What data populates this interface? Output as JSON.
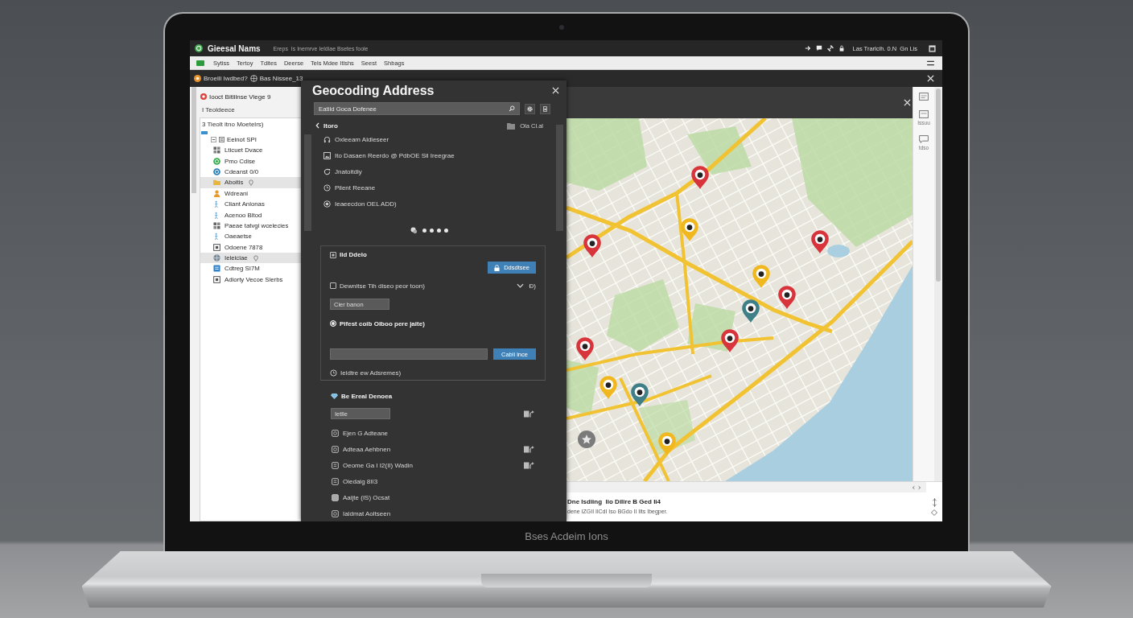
{
  "app": {
    "title": "Gieesal Nams",
    "menu_hint": "Ereps  Is Inemrve Ieldiae Bsetes foole",
    "status": "Las Trarlcih. 0.N  Gn Lis"
  },
  "menu": [
    "Sytiss",
    "Tertoy",
    "Tdites",
    "Deerse",
    "Tels Mdee Itlshs",
    "Seest",
    "Shbags"
  ],
  "tab": {
    "label": "Broeili Iwdbed?",
    "file": "Bas Nissee_13"
  },
  "sidebar": {
    "header": "Iooct Bitlilnse Viege 9",
    "lines": [
      "I Teoldeece",
      "3 Tieolt itno Moetelrs)"
    ],
    "tree": {
      "label": "Eeinot SPI",
      "expanded": true,
      "children": [
        {
          "label": "Lticuet Dvace",
          "selected": false,
          "pinned": false
        },
        {
          "label": "Pmo Cdise",
          "selected": false,
          "pinned": false
        },
        {
          "label": "Cdeanst 0/0",
          "selected": false,
          "pinned": false
        },
        {
          "label": "Aboitis",
          "selected": true,
          "pinned": true
        },
        {
          "label": "Wdreani",
          "selected": false,
          "pinned": false
        },
        {
          "label": "Cliant Anlonas",
          "selected": false,
          "pinned": false
        },
        {
          "label": "Acenoo Bltod",
          "selected": false,
          "pinned": false
        },
        {
          "label": "Paeae tatvgi wcelecies",
          "selected": false,
          "pinned": false
        },
        {
          "label": "Oaeaetse",
          "selected": false,
          "pinned": false
        },
        {
          "label": "Odoene 7878",
          "selected": false,
          "pinned": false
        },
        {
          "label": "Ieleiclae",
          "selected": true,
          "pinned": true
        },
        {
          "label": "Cdtreg SI7M",
          "selected": false,
          "pinned": false
        },
        {
          "label": "Adiorty Vecoe Slerbs",
          "selected": false,
          "pinned": false
        }
      ]
    }
  },
  "dialog": {
    "title": "Geocoding Address",
    "search": {
      "value": "Eatild Goca Dofenee"
    },
    "back": "Itoro",
    "folder": "Ola Cl.al",
    "results": [
      "Oxleeam Aldleseer",
      "Ito Dasaen Reerdo @ PdbOE Sil Ireegrae",
      "Jnatoitdiy",
      "Pilent Reeane",
      "Ieaeecdon OEL ADD)"
    ],
    "options": {
      "heading": {
        "label": "Ild Ddelo",
        "checked": true
      },
      "action": "Ddsdtsee",
      "toggle": {
        "label": "Dewnitse Tih diseo peor toon)",
        "checked": false
      },
      "aside": "Ð)",
      "field": {
        "value": "Cier banon"
      },
      "radio": {
        "label": "Pifest coib Oiboo pere jaite)",
        "selected": true
      },
      "submit": "Cabli ince",
      "note": "Ieldtre ew Adsremes)"
    },
    "batch": {
      "title": "Be Ereal Denoea",
      "field": {
        "value": "Ietlle"
      },
      "items": [
        {
          "label": "Ejen G Adteane",
          "export": false
        },
        {
          "label": "Adteaa Aehbnen",
          "export": true
        },
        {
          "label": "Oeome Ga I I2(II) Wadin",
          "export": true
        },
        {
          "label": "Oiedaig 8II3",
          "export": false
        },
        {
          "label": "Aaijte (IS) Ocsat",
          "export": false
        },
        {
          "label": "Ialdmat Aoltseen",
          "export": false
        }
      ]
    }
  },
  "toolbar": [
    {
      "label": "Issuu"
    },
    {
      "label": "tdso"
    }
  ],
  "details": {
    "title": "Dne Isdiing  lio Dilire B Ged Ii4",
    "text": "dene IZGII IlCdI Iso BGdo II Ilts Ibegper."
  },
  "laptop": {
    "brand": "Bses Acdeim Ions"
  }
}
